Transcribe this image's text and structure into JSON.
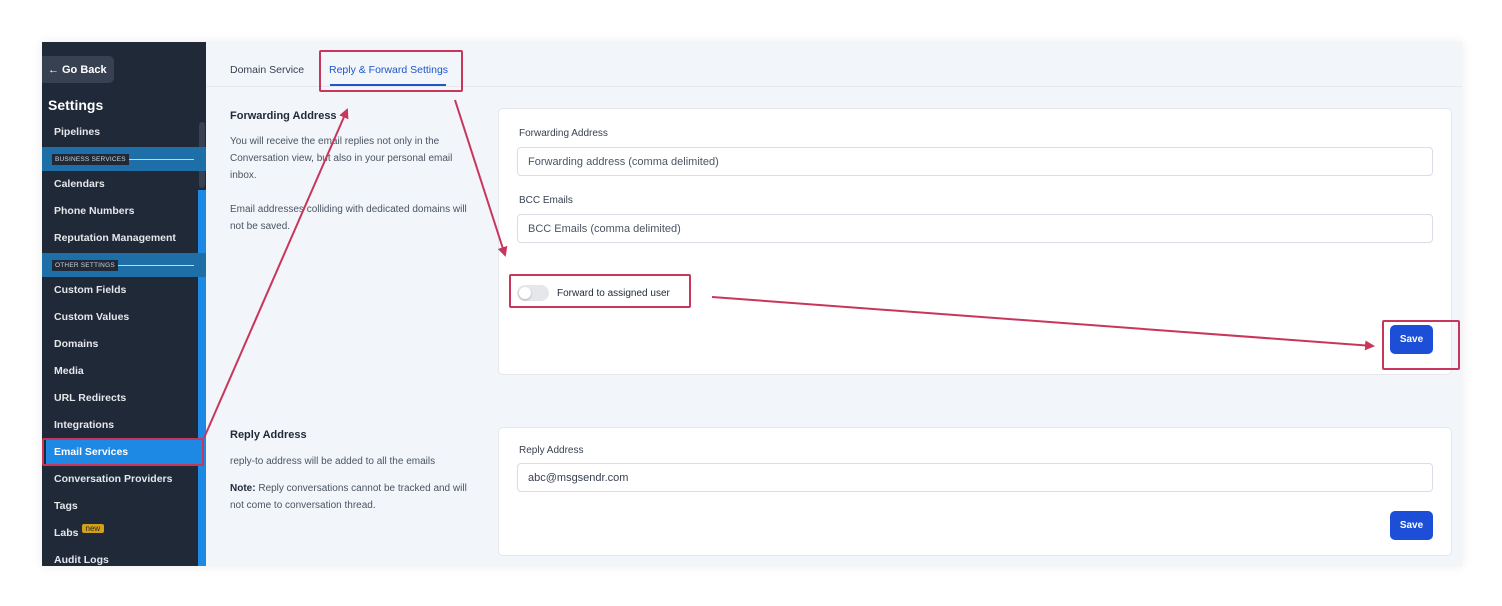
{
  "sidebar": {
    "go_back": "Go Back",
    "title": "Settings",
    "items": [
      {
        "label": "Pipelines"
      },
      {
        "label": "Calendars"
      },
      {
        "label": "Phone Numbers"
      },
      {
        "label": "Reputation Management"
      },
      {
        "label": "Custom Fields"
      },
      {
        "label": "Custom Values"
      },
      {
        "label": "Domains"
      },
      {
        "label": "Media"
      },
      {
        "label": "URL Redirects"
      },
      {
        "label": "Integrations"
      },
      {
        "label": "Email Services"
      },
      {
        "label": "Conversation Providers"
      },
      {
        "label": "Tags"
      },
      {
        "label": "Labs"
      },
      {
        "label": "Audit Logs"
      }
    ],
    "sections": [
      "BUSINESS SERVICES",
      "OTHER SETTINGS"
    ],
    "labs_badge": "new",
    "active_item": "Email Services"
  },
  "tabs": [
    {
      "label": "Domain Service"
    },
    {
      "label": "Reply & Forward Settings"
    }
  ],
  "forwarding": {
    "title": "Forwarding Address",
    "desc1": "You will receive the email replies not only in the Conversation view, but also in your personal email inbox.",
    "desc2": "Email addresses colliding with dedicated domains will not be saved.",
    "forwarding_label": "Forwarding Address",
    "forwarding_placeholder": "Forwarding address (comma delimited)",
    "bcc_label": "BCC Emails",
    "bcc_placeholder": "BCC Emails (comma delimited)",
    "toggle_label": "Forward to assigned user",
    "toggle_on": false,
    "save": "Save"
  },
  "reply": {
    "title": "Reply Address",
    "desc1": "reply-to address will be added to all the emails",
    "note_label": "Note:",
    "note_text": " Reply conversations cannot be tracked and will not come to conversation thread.",
    "reply_label": "Reply Address",
    "reply_value": "abc@msgsendr.com",
    "save": "Save"
  },
  "colors": {
    "sidebar_bg": "#1f2937",
    "active_blue": "#1e88e5",
    "primary_button": "#1d4ed8",
    "annotation": "#c8365c"
  }
}
